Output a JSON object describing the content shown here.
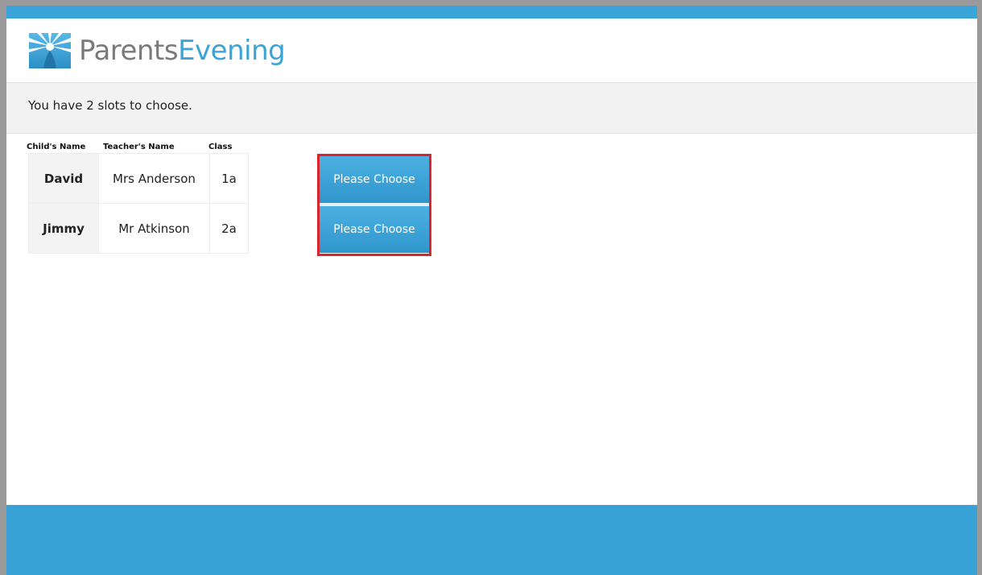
{
  "brand": {
    "name_part1": "Parents",
    "name_part2": "Evening",
    "logo_icon": "sunburst-logo-icon"
  },
  "notice": {
    "text": "You have 2 slots to choose."
  },
  "table": {
    "headers": {
      "child": "Child's Name",
      "teacher": "Teacher's Name",
      "class": "Class"
    },
    "rows": [
      {
        "child": "David",
        "teacher": "Mrs Anderson",
        "class": "1a",
        "action": "Please Choose"
      },
      {
        "child": "Jimmy",
        "teacher": "Mr Atkinson",
        "class": "2a",
        "action": "Please Choose"
      }
    ]
  },
  "colors": {
    "accent": "#3aa3d7",
    "highlight_border": "#d8262f",
    "notice_bg": "#f2f2f2"
  }
}
